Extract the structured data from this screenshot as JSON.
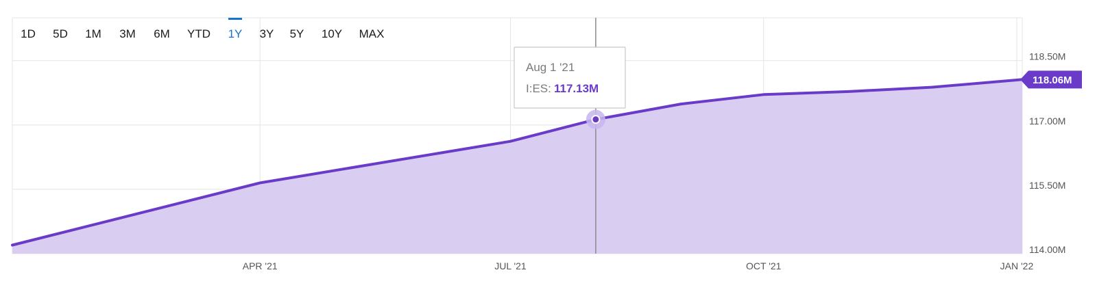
{
  "range_buttons": [
    {
      "label": "1D",
      "active": false
    },
    {
      "label": "5D",
      "active": false
    },
    {
      "label": "1M",
      "active": false
    },
    {
      "label": "3M",
      "active": false
    },
    {
      "label": "6M",
      "active": false
    },
    {
      "label": "YTD",
      "active": false
    },
    {
      "label": "1Y",
      "active": true
    },
    {
      "label": "3Y",
      "active": false
    },
    {
      "label": "5Y",
      "active": false
    },
    {
      "label": "10Y",
      "active": false
    },
    {
      "label": "MAX",
      "active": false
    }
  ],
  "tooltip": {
    "date": "Aug 1 '21",
    "series": "I:ES:",
    "value": "117.13M"
  },
  "last_value_badge": "118.06M",
  "colors": {
    "line": "#6a3bc8",
    "fill": "#d9cef2",
    "grid": "#e4e4e4",
    "active_button": "#1a73c8",
    "crosshair": "#8a8a8a"
  },
  "chart_data": {
    "type": "area",
    "title": "",
    "xlabel": "",
    "ylabel": "",
    "x_ticks": [
      "APR '21",
      "JUL '21",
      "OCT '21",
      "JAN '22"
    ],
    "y_ticks": [
      "114.00M",
      "115.50M",
      "117.00M",
      "118.50M"
    ],
    "y_tick_values": [
      114.0,
      115.5,
      117.0,
      118.5
    ],
    "ylim": [
      114.0,
      119.5
    ],
    "xlim": [
      "2021-01-01",
      "2022-01-03"
    ],
    "grid": true,
    "y_axis_position": "right",
    "series": [
      {
        "name": "I:ES",
        "x": [
          "2021-01-01",
          "2021-04-01",
          "2021-07-01",
          "2021-08-01",
          "2021-09-01",
          "2021-10-01",
          "2021-11-01",
          "2021-12-01",
          "2022-01-01",
          "2022-01-03"
        ],
        "values": [
          114.2,
          115.65,
          116.62,
          117.13,
          117.49,
          117.71,
          117.78,
          117.88,
          118.05,
          118.06
        ]
      }
    ]
  }
}
